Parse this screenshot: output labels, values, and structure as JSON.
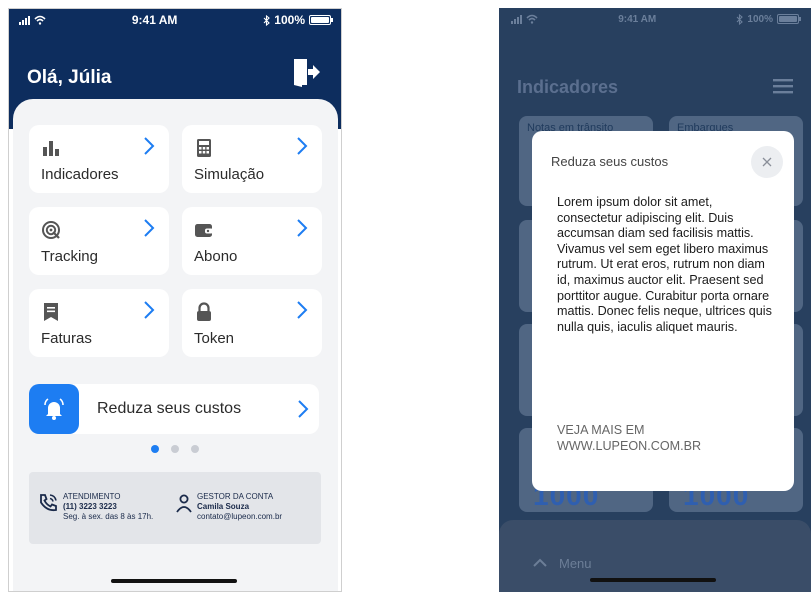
{
  "status_bar": {
    "time": "9:41 AM",
    "battery": "100%"
  },
  "home": {
    "greeting": "Olá, Júlia",
    "cards": [
      {
        "label": "Indicadores",
        "icon": "bar-chart-icon"
      },
      {
        "label": "Simulação",
        "icon": "calculator-icon"
      },
      {
        "label": "Tracking",
        "icon": "radar-icon"
      },
      {
        "label": "Abono",
        "icon": "wallet-icon"
      },
      {
        "label": "Faturas",
        "icon": "receipt-icon"
      },
      {
        "label": "Token",
        "icon": "lock-icon"
      }
    ],
    "banner": {
      "label": "Reduza seus custos",
      "icon": "bell-icon"
    },
    "carousel": {
      "pages": 3,
      "active": 0
    },
    "contact": {
      "attendance": {
        "title": "ATENDIMENTO",
        "phone": "(11) 3223 3223",
        "hours": "Seg. à sex. das 8 às 17h."
      },
      "manager": {
        "title": "GESTOR DA CONTA",
        "name": "Camila Souza",
        "email": "contato@lupeon.com.br"
      }
    }
  },
  "indicators_screen": {
    "title": "Indicadores",
    "card_labels": [
      "Notas em trânsito",
      "Embarques"
    ],
    "numbers": [
      "1000",
      "1000"
    ],
    "bottom_menu_label": "Menu"
  },
  "modal": {
    "title": "Reduza seus custos",
    "body": "Lorem ipsum dolor sit amet, consectetur adipiscing elit. Duis accumsan diam sed facilisis mattis. Vivamus vel sem eget libero maximus rutrum. Ut erat eros, rutrum non diam id, maximus auctor elit. Praesent sed porttitor augue. Curabitur porta ornare mattis. Donec felis neque, ultrices quis nulla quis, iaculis aliquet mauris.",
    "link": "VEJA MAIS EM WWW.LUPEON.COM.BR"
  },
  "colors": {
    "navy": "#0d2d5e",
    "accent": "#1d7df2",
    "panel": "#f3f4f6"
  }
}
